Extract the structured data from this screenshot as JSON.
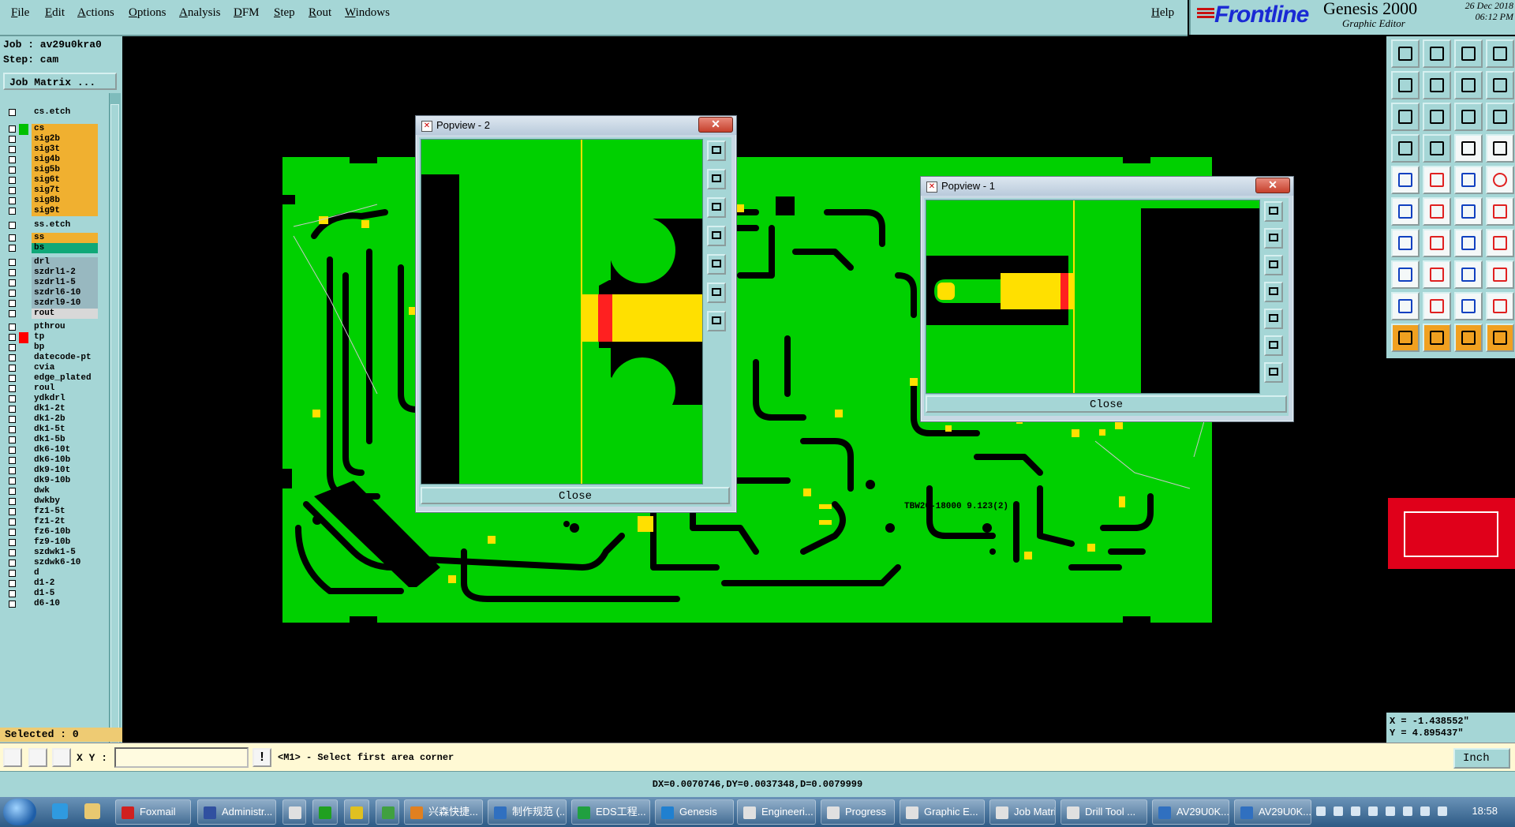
{
  "menubar": {
    "items": [
      "File",
      "Edit",
      "Actions",
      "Options",
      "Analysis",
      "DFM",
      "Step",
      "Rout",
      "Windows"
    ],
    "help": "Help"
  },
  "branding": {
    "logo": "Frontline",
    "product": "Genesis 2000",
    "subtitle": "Graphic Editor",
    "date": "26 Dec 2018",
    "time": "06:12 PM"
  },
  "job": {
    "job_line": "Job : av29u0kra0",
    "step_line": "Step: cam",
    "matrix_button": "Job Matrix ..."
  },
  "layers": [
    {
      "name": "cs.etch",
      "color": "#a5d6d6",
      "flag": ""
    },
    {
      "name": "cs",
      "color": "#f0b030",
      "flag": "#00c000",
      "active": true
    },
    {
      "name": "sig2b",
      "color": "#f0b030",
      "flag": ""
    },
    {
      "name": "sig3t",
      "color": "#f0b030",
      "flag": ""
    },
    {
      "name": "sig4b",
      "color": "#f0b030",
      "flag": ""
    },
    {
      "name": "sig5b",
      "color": "#f0b030",
      "flag": ""
    },
    {
      "name": "sig6t",
      "color": "#f0b030",
      "flag": ""
    },
    {
      "name": "sig7t",
      "color": "#f0b030",
      "flag": ""
    },
    {
      "name": "sig8b",
      "color": "#f0b030",
      "flag": ""
    },
    {
      "name": "sig9t",
      "color": "#f0b030",
      "flag": ""
    },
    {
      "name": "ss.etch",
      "color": "#a5d6d6",
      "flag": ""
    },
    {
      "name": "ss",
      "color": "#f0b030",
      "flag": ""
    },
    {
      "name": "bs",
      "color": "#10a878",
      "flag": ""
    },
    {
      "name": "drl",
      "color": "#98b8c0",
      "flag": ""
    },
    {
      "name": "szdrl1-2",
      "color": "#98b8c0",
      "flag": ""
    },
    {
      "name": "szdrl1-5",
      "color": "#98b8c0",
      "flag": ""
    },
    {
      "name": "szdrl6-10",
      "color": "#98b8c0",
      "flag": ""
    },
    {
      "name": "szdrl9-10",
      "color": "#98b8c0",
      "flag": ""
    },
    {
      "name": "rout",
      "color": "#d8d8d8",
      "flag": ""
    },
    {
      "name": "pthrou",
      "color": "#a5d6d6",
      "flag": ""
    },
    {
      "name": "tp",
      "color": "#a5d6d6",
      "flag": "#ff0000"
    },
    {
      "name": "bp",
      "color": "#a5d6d6",
      "flag": ""
    },
    {
      "name": "datecode-pt",
      "color": "#a5d6d6",
      "flag": ""
    },
    {
      "name": "cvia",
      "color": "#a5d6d6",
      "flag": ""
    },
    {
      "name": "edge_plated",
      "color": "#a5d6d6",
      "flag": ""
    },
    {
      "name": "roul",
      "color": "#a5d6d6",
      "flag": ""
    },
    {
      "name": "ydkdrl",
      "color": "#a5d6d6",
      "flag": ""
    },
    {
      "name": "dk1-2t",
      "color": "#a5d6d6",
      "flag": ""
    },
    {
      "name": "dk1-2b",
      "color": "#a5d6d6",
      "flag": ""
    },
    {
      "name": "dk1-5t",
      "color": "#a5d6d6",
      "flag": ""
    },
    {
      "name": "dk1-5b",
      "color": "#a5d6d6",
      "flag": ""
    },
    {
      "name": "dk6-10t",
      "color": "#a5d6d6",
      "flag": ""
    },
    {
      "name": "dk6-10b",
      "color": "#a5d6d6",
      "flag": ""
    },
    {
      "name": "dk9-10t",
      "color": "#a5d6d6",
      "flag": ""
    },
    {
      "name": "dk9-10b",
      "color": "#a5d6d6",
      "flag": ""
    },
    {
      "name": "dwk",
      "color": "#a5d6d6",
      "flag": ""
    },
    {
      "name": "dwkby",
      "color": "#a5d6d6",
      "flag": ""
    },
    {
      "name": "fz1-5t",
      "color": "#a5d6d6",
      "flag": ""
    },
    {
      "name": "fz1-2t",
      "color": "#a5d6d6",
      "flag": ""
    },
    {
      "name": "fz6-10b",
      "color": "#a5d6d6",
      "flag": ""
    },
    {
      "name": "fz9-10b",
      "color": "#a5d6d6",
      "flag": ""
    },
    {
      "name": "szdwk1-5",
      "color": "#a5d6d6",
      "flag": ""
    },
    {
      "name": "szdwk6-10",
      "color": "#a5d6d6",
      "flag": ""
    },
    {
      "name": "d",
      "color": "#a5d6d6",
      "flag": ""
    },
    {
      "name": "d1-2",
      "color": "#a5d6d6",
      "flag": ""
    },
    {
      "name": "d1-5",
      "color": "#a5d6d6",
      "flag": ""
    },
    {
      "name": "d6-10",
      "color": "#a5d6d6",
      "flag": ""
    }
  ],
  "selected": "Selected : 0",
  "board_text": "TBW20-18000 9.123(2)",
  "popview2": {
    "title": "Popview - 2",
    "close": "Close"
  },
  "popview1": {
    "title": "Popview - 1",
    "close": "Close"
  },
  "coords": {
    "x": "X = -1.438552\"",
    "y": "Y =  4.895437\""
  },
  "command": {
    "xy_label": "X Y :",
    "xy_value": "",
    "prompt": "<M1> - Select first area corner",
    "unit": "Inch"
  },
  "status": "DX=0.0070746,DY=0.0037348,D=0.0079999",
  "colors": {
    "board": "#00d000",
    "copper": "#000000",
    "pad": "#ffe000",
    "panel": "#a5d6d6"
  },
  "taskbar": {
    "tasks": [
      {
        "label": "Foxmail",
        "icon": "#d02020"
      },
      {
        "label": "Administr...",
        "icon": "#3050a0"
      },
      {
        "label": "",
        "icon": "#e0e0e0"
      },
      {
        "label": "",
        "icon": "#20a020"
      },
      {
        "label": "",
        "icon": "#e0c020"
      },
      {
        "label": "",
        "icon": "#40a040"
      },
      {
        "label": "兴森快捷...",
        "icon": "#e08020"
      },
      {
        "label": "制作规范 (...",
        "icon": "#3070c0"
      },
      {
        "label": "EDS工程...",
        "icon": "#20a040"
      },
      {
        "label": "Genesis",
        "icon": "#2080d0"
      },
      {
        "label": "Engineeri...",
        "icon": "#e0e0e0"
      },
      {
        "label": "Progress",
        "icon": "#e0e0e0"
      },
      {
        "label": "Graphic E...",
        "icon": "#e0e0e0"
      },
      {
        "label": "Job Matri...",
        "icon": "#e0e0e0"
      },
      {
        "label": "Drill Tool ...",
        "icon": "#e0e0e0"
      },
      {
        "label": "AV29U0K...",
        "icon": "#3070c0"
      },
      {
        "label": "AV29U0K...",
        "icon": "#3070c0"
      }
    ],
    "clock": "18:58"
  }
}
